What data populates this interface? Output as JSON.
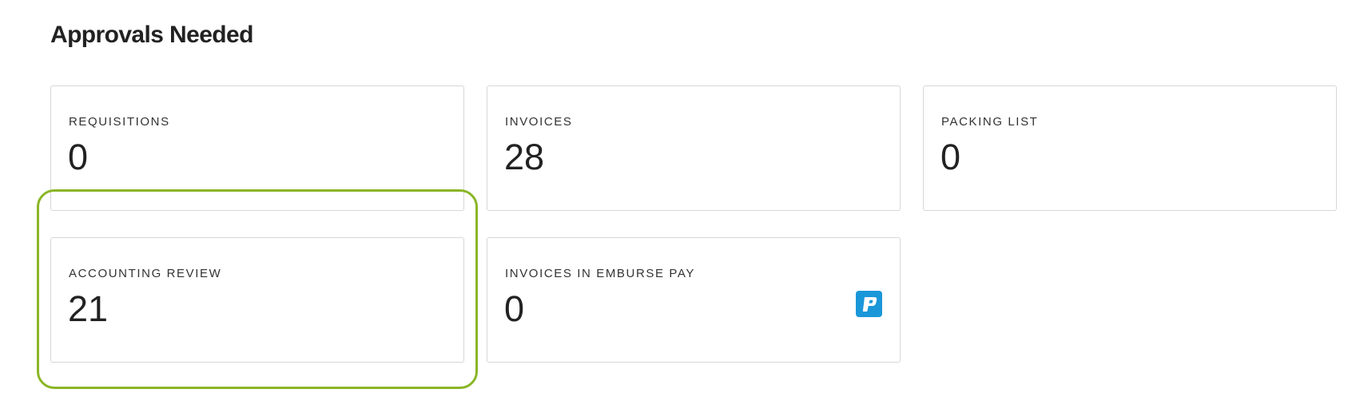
{
  "page": {
    "title": "Approvals Needed"
  },
  "tiles": [
    {
      "id": "requisitions",
      "label": "REQUISITIONS",
      "count": "0"
    },
    {
      "id": "invoices",
      "label": "INVOICES",
      "count": "28"
    },
    {
      "id": "packing-list",
      "label": "PACKING LIST",
      "count": "0"
    },
    {
      "id": "accounting-review",
      "label": "ACCOUNTING REVIEW",
      "count": "21"
    },
    {
      "id": "invoices-in-emburse-pay",
      "label": "INVOICES IN EMBURSE PAY",
      "count": "0",
      "icon": "emburse-pay-icon"
    }
  ],
  "colors": {
    "highlight": "#8ab626",
    "emburse_brand": "#1a97d9",
    "tile_border": "#d7d7d7"
  }
}
